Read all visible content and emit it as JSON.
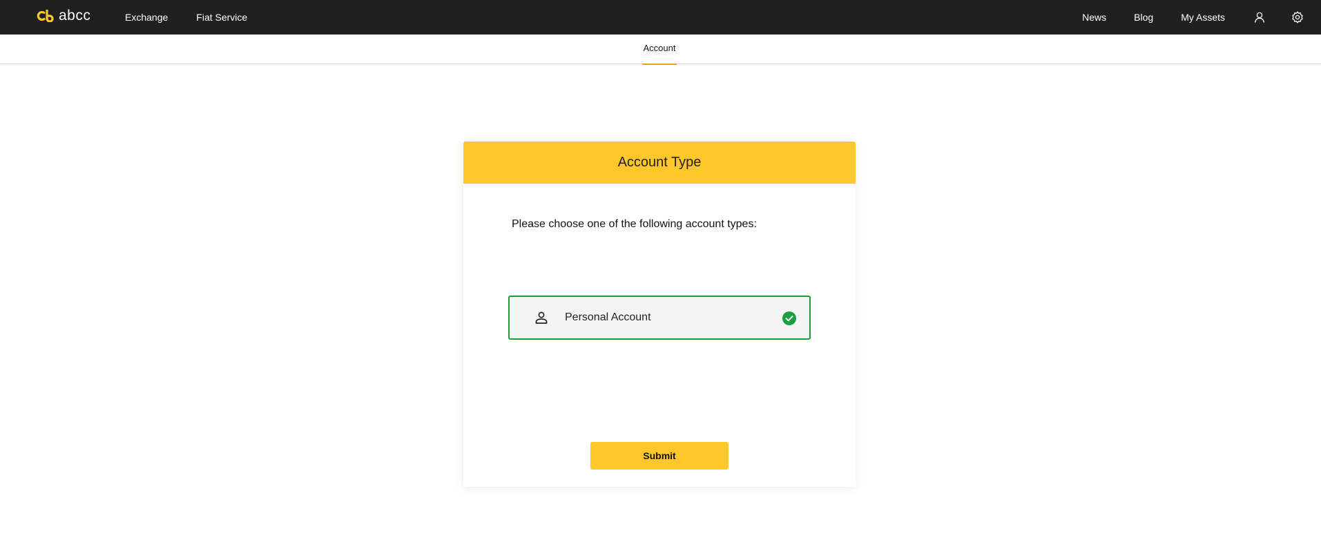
{
  "navbar": {
    "logo_text": "abcc",
    "left_links": [
      "Exchange",
      "Fiat Service"
    ],
    "right_links": [
      "News",
      "Blog",
      "My Assets"
    ],
    "icons": [
      "user-icon",
      "settings-icon"
    ],
    "background": "#202020",
    "brand_color": "#ffc72c"
  },
  "subnav": {
    "active_tab": "Account",
    "accent": "#f0a016"
  },
  "card": {
    "title": "Account Type",
    "prompt": "Please choose one of the following account types:",
    "options": [
      {
        "label": "Personal Account",
        "icon": "person-icon",
        "selected": true
      }
    ],
    "selected_color": "#1c9e3f",
    "submit_label": "Submit"
  }
}
